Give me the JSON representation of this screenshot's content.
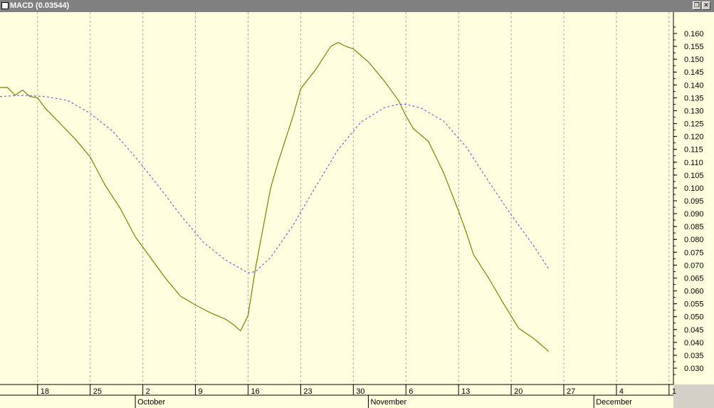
{
  "window": {
    "title": "MACD (0.03544)",
    "restore_glyph": "❐",
    "close_glyph": "✕"
  },
  "colors": {
    "plot_bg": "#ffffe0",
    "macd_line": "#808000",
    "signal_line": "#6a6ad0",
    "grid": "#a8a8a8"
  },
  "chart_data": {
    "type": "line",
    "title": "",
    "ylabel": "",
    "ylim": [
      0.026,
      0.168
    ],
    "x_range": [
      "2007-09-13",
      "2007-12-12"
    ],
    "grid": "vertical dashed",
    "yticks": [
      "0.030",
      "0.035",
      "0.040",
      "0.045",
      "0.050",
      "0.055",
      "0.060",
      "0.065",
      "0.070",
      "0.075",
      "0.080",
      "0.085",
      "0.090",
      "0.095",
      "0.100",
      "0.105",
      "0.110",
      "0.115",
      "0.120",
      "0.125",
      "0.130",
      "0.135",
      "0.140",
      "0.145",
      "0.150",
      "0.155",
      "0.160"
    ],
    "day_ticks": [
      {
        "date": "2007-09-18",
        "label": "18"
      },
      {
        "date": "2007-09-25",
        "label": "25"
      },
      {
        "date": "2007-10-02",
        "label": "2"
      },
      {
        "date": "2007-10-09",
        "label": "9"
      },
      {
        "date": "2007-10-16",
        "label": "16"
      },
      {
        "date": "2007-10-23",
        "label": "23"
      },
      {
        "date": "2007-10-30",
        "label": "30"
      },
      {
        "date": "2007-11-06",
        "label": "6"
      },
      {
        "date": "2007-11-13",
        "label": "13"
      },
      {
        "date": "2007-11-20",
        "label": "20"
      },
      {
        "date": "2007-11-27",
        "label": "27"
      },
      {
        "date": "2007-12-04",
        "label": "4"
      },
      {
        "date": "2007-12-11",
        "label": "1"
      }
    ],
    "month_ticks": [
      {
        "date": "2007-10-01",
        "label": "October"
      },
      {
        "date": "2007-11-01",
        "label": "November"
      },
      {
        "date": "2007-12-01",
        "label": "December"
      }
    ],
    "series": [
      {
        "key": "macd",
        "style": "solid",
        "x": [
          "2007-09-13",
          "2007-09-14",
          "2007-09-15",
          "2007-09-16",
          "2007-09-17",
          "2007-09-18",
          "2007-09-19",
          "2007-09-21",
          "2007-09-23",
          "2007-09-25",
          "2007-09-27",
          "2007-09-29",
          "2007-10-01",
          "2007-10-03",
          "2007-10-05",
          "2007-10-07",
          "2007-10-09",
          "2007-10-11",
          "2007-10-13",
          "2007-10-14",
          "2007-10-15",
          "2007-10-16",
          "2007-10-17",
          "2007-10-19",
          "2007-10-20",
          "2007-10-22",
          "2007-10-23",
          "2007-10-25",
          "2007-10-26",
          "2007-10-27",
          "2007-10-28",
          "2007-10-29",
          "2007-10-30",
          "2007-11-01",
          "2007-11-03",
          "2007-11-05",
          "2007-11-06",
          "2007-11-07",
          "2007-11-09",
          "2007-11-11",
          "2007-11-13",
          "2007-11-14",
          "2007-11-15",
          "2007-11-17",
          "2007-11-19",
          "2007-11-21",
          "2007-11-23",
          "2007-11-25"
        ],
        "y": [
          0.139,
          0.139,
          0.136,
          0.138,
          0.1355,
          0.135,
          0.131,
          0.125,
          0.119,
          0.112,
          0.101,
          0.092,
          0.081,
          0.073,
          0.065,
          0.058,
          0.0545,
          0.0515,
          0.049,
          0.047,
          0.0445,
          0.0505,
          0.069,
          0.1,
          0.11,
          0.128,
          0.1385,
          0.146,
          0.1505,
          0.155,
          0.1565,
          0.155,
          0.154,
          0.149,
          0.142,
          0.134,
          0.128,
          0.123,
          0.118,
          0.106,
          0.091,
          0.083,
          0.074,
          0.065,
          0.055,
          0.0455,
          0.0415,
          0.0365
        ]
      },
      {
        "key": "signal",
        "style": "dashed",
        "x": [
          "2007-09-13",
          "2007-09-16",
          "2007-09-19",
          "2007-09-22",
          "2007-09-25",
          "2007-09-28",
          "2007-10-01",
          "2007-10-04",
          "2007-10-07",
          "2007-10-10",
          "2007-10-13",
          "2007-10-16",
          "2007-10-17",
          "2007-10-19",
          "2007-10-22",
          "2007-10-25",
          "2007-10-28",
          "2007-10-31",
          "2007-11-03",
          "2007-11-05",
          "2007-11-06",
          "2007-11-08",
          "2007-11-11",
          "2007-11-14",
          "2007-11-17",
          "2007-11-20",
          "2007-11-23",
          "2007-11-25"
        ],
        "y": [
          0.1355,
          0.136,
          0.1355,
          0.134,
          0.129,
          0.122,
          0.112,
          0.101,
          0.0895,
          0.079,
          0.072,
          0.067,
          0.0675,
          0.073,
          0.0855,
          0.1005,
          0.115,
          0.1255,
          0.131,
          0.1325,
          0.1325,
          0.131,
          0.126,
          0.116,
          0.1025,
          0.0895,
          0.0775,
          0.0685
        ]
      }
    ]
  }
}
